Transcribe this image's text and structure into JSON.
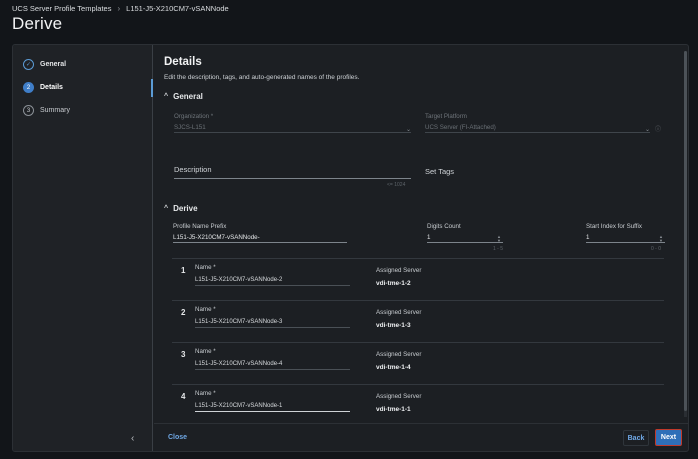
{
  "breadcrumb": {
    "parent": "UCS Server Profile Templates",
    "separator": "›",
    "current": "L151-J5-X210CM7-vSANNode"
  },
  "page": {
    "title": "Derive"
  },
  "steps": [
    {
      "num": "✓",
      "label": "General",
      "state": "done"
    },
    {
      "num": "2",
      "label": "Details",
      "state": "active"
    },
    {
      "num": "3",
      "label": "Summary",
      "state": "todo"
    }
  ],
  "sidebar": {
    "collapse_icon": "‹"
  },
  "details": {
    "title": "Details",
    "description": "Edit the description, tags, and auto-generated names of the profiles."
  },
  "general": {
    "heading": "General",
    "chevron": "^",
    "organization": {
      "label": "Organization *",
      "value": "SJCS-L151"
    },
    "target_platform": {
      "label": "Target Platform",
      "value": "UCS Server (FI-Attached)"
    },
    "description_label": "Description",
    "description_counter": "<= 1024",
    "set_tags": "Set Tags"
  },
  "derive": {
    "heading": "Derive",
    "chevron": "^",
    "prefix": {
      "label": "Profile Name Prefix",
      "value": "L151-J5-X210CM7-vSANNode-"
    },
    "digits": {
      "label": "Digits Count",
      "value": "1",
      "hint": "1 - 5"
    },
    "start_index": {
      "label": "Start Index for Suffix",
      "value": "1",
      "hint": "0 - 0"
    },
    "name_label": "Name *",
    "server_label": "Assigned Server",
    "rows": [
      {
        "num": "1",
        "name": "L151-J5-X210CM7-vSANNode-2",
        "server": "vdi-tme-1-2"
      },
      {
        "num": "2",
        "name": "L151-J5-X210CM7-vSANNode-3",
        "server": "vdi-tme-1-3"
      },
      {
        "num": "3",
        "name": "L151-J5-X210CM7-vSANNode-4",
        "server": "vdi-tme-1-4"
      },
      {
        "num": "4",
        "name": "L151-J5-X210CM7-vSANNode-1",
        "server": "vdi-tme-1-1"
      }
    ]
  },
  "footer": {
    "close": "Close",
    "back": "Back",
    "next": "Next"
  },
  "colors": {
    "accent": "#2f6fb8",
    "link": "#6fa8e6",
    "next_outline": "#c0392b"
  }
}
